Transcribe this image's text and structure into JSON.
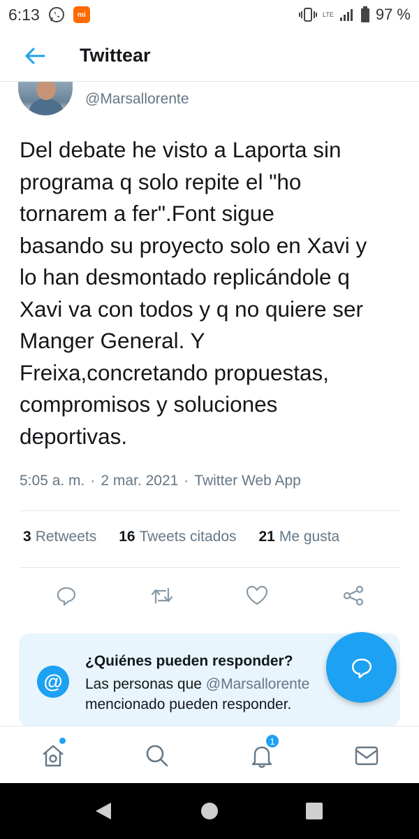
{
  "status_bar": {
    "time": "6:13",
    "battery": "97 %",
    "network": "LTE",
    "icons": [
      "whatsapp-icon",
      "mi-icon",
      "vibrate-icon",
      "signal-icon",
      "battery-icon"
    ],
    "mi_label": "mi"
  },
  "header": {
    "title": "Twittear",
    "back_icon": "arrow-left-icon"
  },
  "tweet": {
    "handle": "@Marsallorente",
    "text": "Del debate he visto a Laporta sin\nprograma q solo repite el \"ho\ntornarem a fer\".Font sigue\nbasando su proyecto solo en Xavi y\nlo han desmontado replicándole q\nXavi va con todos y q no quiere ser\nManger General. Y\nFreixa,concretando propuestas,\ncompromisos y soluciones\ndeportivas.",
    "time": "5:05 a. m.",
    "date": "2 mar. 2021",
    "source": "Twitter Web App",
    "separator": "·"
  },
  "stats": {
    "retweets_count": "3",
    "retweets_label": "Retweets",
    "quotes_count": "16",
    "quotes_label": "Tweets citados",
    "likes_count": "21",
    "likes_label": "Me gusta"
  },
  "actions": [
    "reply-icon",
    "retweet-icon",
    "like-icon",
    "share-icon"
  ],
  "reply_card": {
    "title": "¿Quiénes pueden responder?",
    "body_prefix": "Las personas que ",
    "mention": "@Marsallorente",
    "body_suffix": "mencionado pueden responder.",
    "at_symbol": "@"
  },
  "bottom_nav": {
    "notification_count": "1"
  },
  "colors": {
    "accent": "#1da1f2",
    "muted": "#657786",
    "card_bg": "#e8f5fd"
  }
}
